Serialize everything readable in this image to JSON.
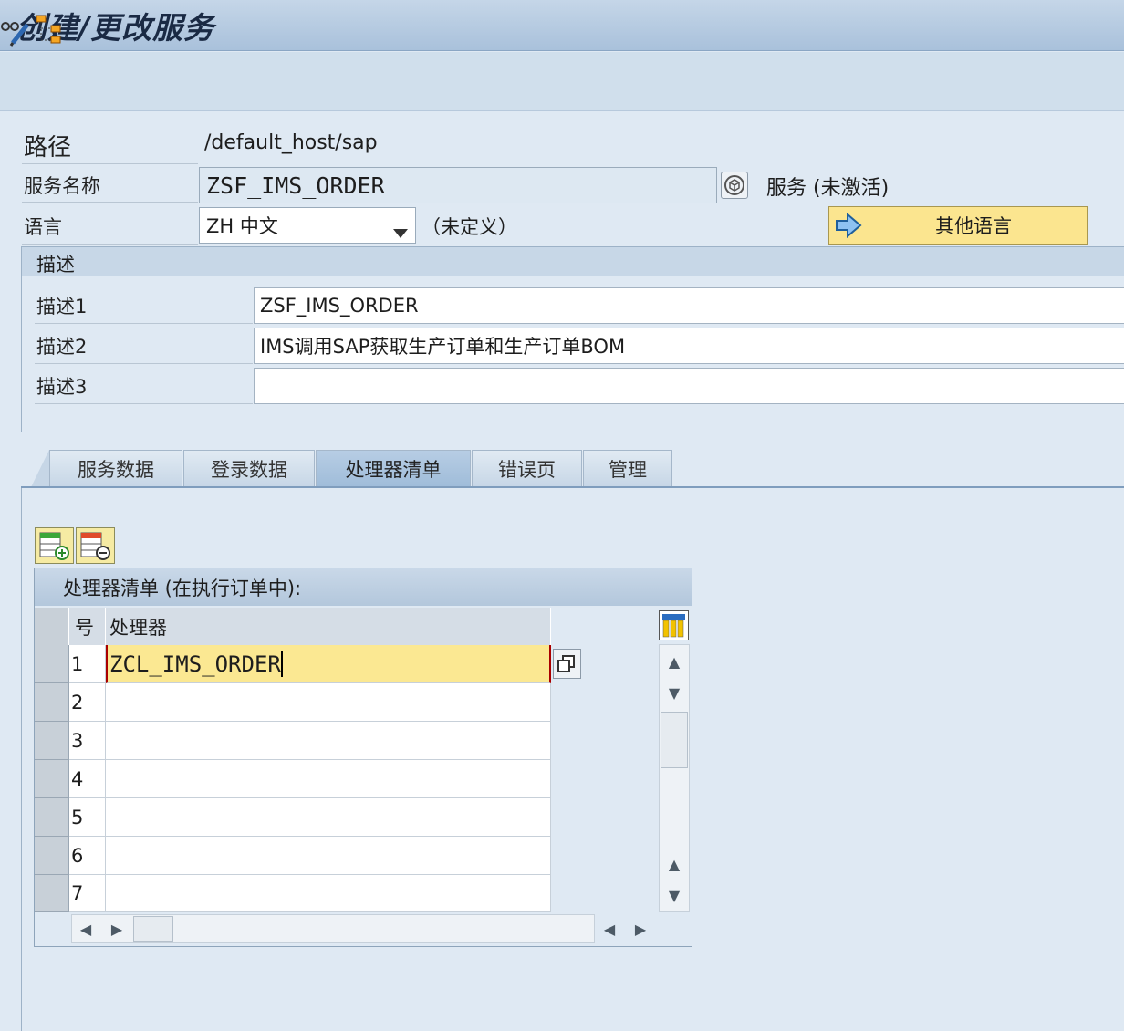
{
  "window": {
    "title": "创建/更改服务"
  },
  "form": {
    "path_label": "路径",
    "path_value": "/default_host/sap",
    "service_name_label": "服务名称",
    "service_name_value": "ZSF_IMS_ORDER",
    "service_status": "服务 (未激活)",
    "language_label": "语言",
    "language_value": "ZH 中文",
    "language_note": "（未定义）",
    "other_language_button": "其他语言"
  },
  "description": {
    "group_title": "描述",
    "rows": [
      {
        "label": "描述1",
        "value": "ZSF_IMS_ORDER"
      },
      {
        "label": "描述2",
        "value": "IMS调用SAP获取生产订单和生产订单BOM"
      },
      {
        "label": "描述3",
        "value": ""
      }
    ]
  },
  "tabs": [
    {
      "label": "服务数据",
      "active": false
    },
    {
      "label": "登录数据",
      "active": false
    },
    {
      "label": "处理器清单",
      "active": true
    },
    {
      "label": "错误页",
      "active": false
    },
    {
      "label": "管理",
      "active": false
    }
  ],
  "handler_table": {
    "title": "处理器清单 (在执行订单中):",
    "columns": [
      "号",
      "处理器"
    ],
    "rows": [
      {
        "num": "1",
        "handler": "ZCL_IMS_ORDER"
      },
      {
        "num": "2",
        "handler": ""
      },
      {
        "num": "3",
        "handler": ""
      },
      {
        "num": "4",
        "handler": ""
      },
      {
        "num": "5",
        "handler": ""
      },
      {
        "num": "6",
        "handler": ""
      },
      {
        "num": "7",
        "handler": ""
      }
    ]
  },
  "icons": {
    "toolbar": [
      "glasses-pencil-icon",
      "hierarchy-icon"
    ],
    "service_name_help": "cube-icon",
    "language_dropdown": "chevron-down-icon",
    "other_language": "arrow-right-icon",
    "table_insert": "insert-row-icon",
    "table_delete": "delete-row-icon",
    "column_settings": "column-settings-icon",
    "value_help": "value-help-icon"
  },
  "colors": {
    "accent_yellow": "#fbe58f",
    "title_bar": "#a9c1db",
    "background": "#dfe9f3"
  }
}
